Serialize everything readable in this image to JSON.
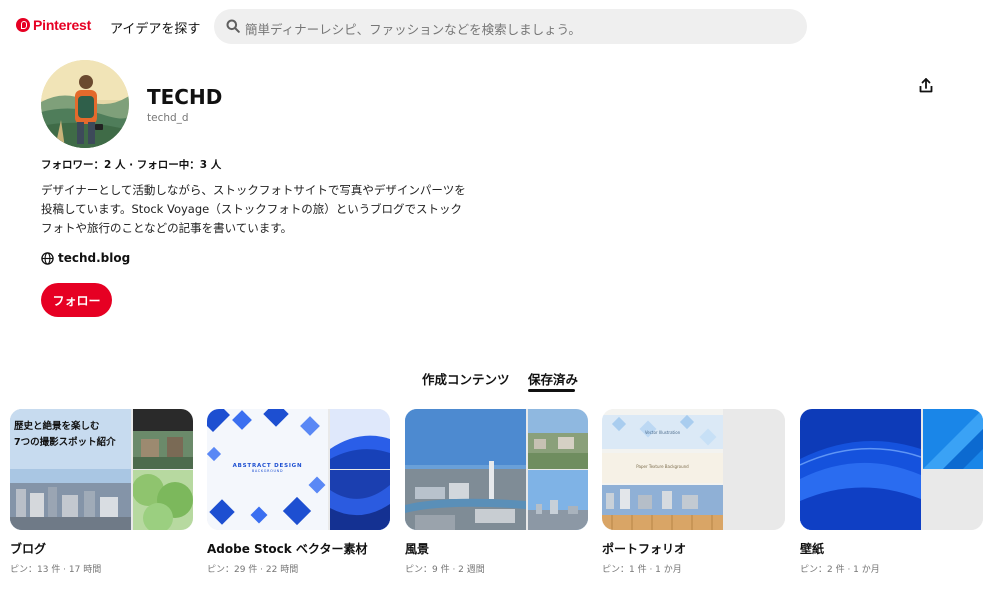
{
  "header": {
    "logo_text": "Pinterest",
    "explore_label": "アイデアを探す",
    "search_placeholder": "簡単ディナーレシピ、ファッションなどを検索しましょう。"
  },
  "profile": {
    "name": "TECHD",
    "handle": "techd_d",
    "follow_stats": "フォロワー：2 人 · フォロー中：3 人",
    "bio": "デザイナーとして活動しながら、ストックフォトサイトで写真やデザインパーツを投稿しています。Stock Voyage（ストックフォトの旅）というブログでストックフォトや旅行のことなどの記事を書いています。",
    "website": "techd.blog",
    "follow_button": "フォロー"
  },
  "tabs": [
    {
      "label": "作成コンテンツ",
      "active": false
    },
    {
      "label": "保存済み",
      "active": true
    }
  ],
  "boards": [
    {
      "title": "ブログ",
      "meta": "ピン：13 件 · 17 時間",
      "cover_text_line1": "歴史と絶景を楽しむ",
      "cover_text_line2": "7つの撮影スポット紹介"
    },
    {
      "title": "Adobe Stock ベクター素材",
      "meta": "ピン：29 件 · 22 時間",
      "cover_text_line1": "ABSTRACT DESIGN",
      "cover_text_line2": "BACKGROUND"
    },
    {
      "title": "風景",
      "meta": "ピン：9 件 · 2 週間"
    },
    {
      "title": "ポートフォリオ",
      "meta": "ピン：1 件 · 1 か月",
      "cover_text_line1": "Vector Illustration",
      "cover_text_line2": "Paper Texture Background"
    },
    {
      "title": "壁紙",
      "meta": "ピン：2 件 · 1 か月"
    }
  ],
  "colors": {
    "brand_red": "#e60023",
    "search_bg": "#efefef",
    "muted_text": "#767676"
  }
}
